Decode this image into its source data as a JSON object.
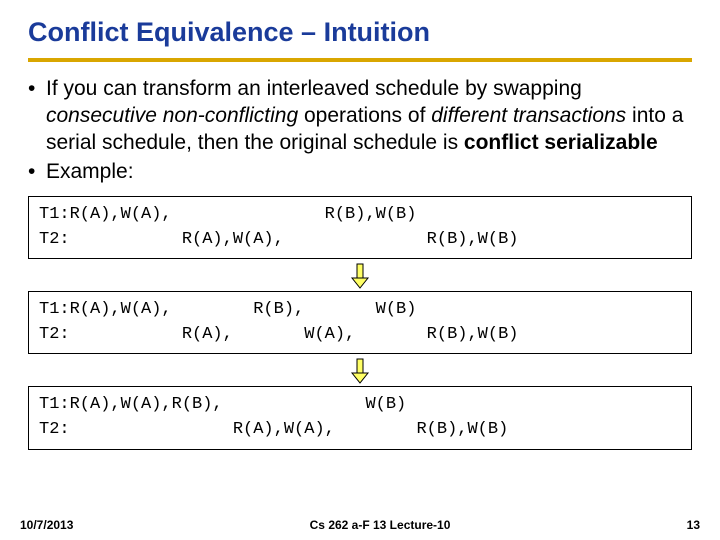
{
  "title": "Conflict Equivalence – Intuition",
  "bullet1_a": "If you can transform an interleaved schedule by swapping ",
  "bullet1_b": "consecutive non-conflicting",
  "bullet1_c": " operations of ",
  "bullet1_d": "different transactions",
  "bullet1_e": " into a serial schedule, then the original schedule is ",
  "bullet1_f": "conflict serializable",
  "bullet2": "Example:",
  "box1": {
    "l1": "T1:R(A),W(A),               R(B),W(B)",
    "l2": "T2:           R(A),W(A),              R(B),W(B)"
  },
  "box2": {
    "l1": "T1:R(A),W(A),        R(B),       W(B)",
    "l2": "T2:           R(A),       W(A),       R(B),W(B)"
  },
  "box3": {
    "l1": "T1:R(A),W(A),R(B),              W(B)",
    "l2": "T2:                R(A),W(A),        R(B),W(B)"
  },
  "footer": {
    "date": "10/7/2013",
    "center": "Cs 262 a-F 13 Lecture-10",
    "page": "13"
  }
}
